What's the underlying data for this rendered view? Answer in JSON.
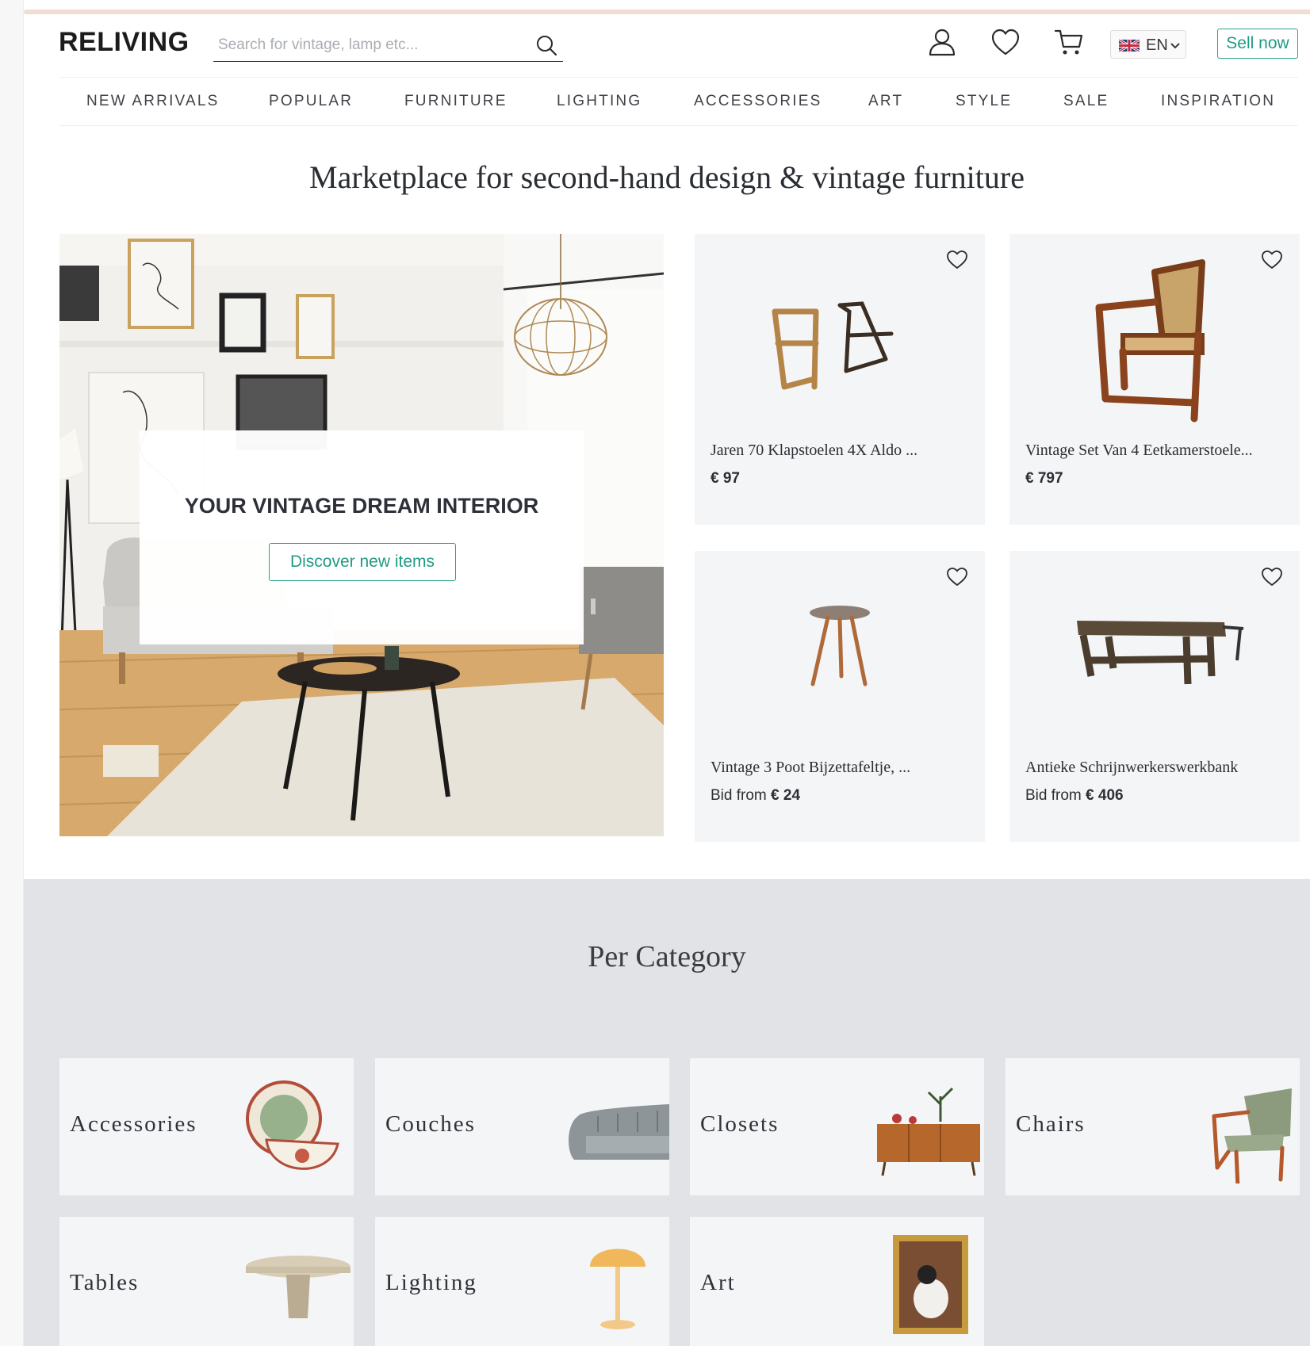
{
  "header": {
    "logo": "RELIVING",
    "search_placeholder": "Search for vintage, lamp etc...",
    "language": "EN",
    "sell_label": "Sell now"
  },
  "nav": {
    "items": [
      "NEW ARRIVALS",
      "POPULAR",
      "FURNITURE",
      "LIGHTING",
      "ACCESSORIES",
      "ART",
      "STYLE",
      "SALE",
      "INSPIRATION"
    ]
  },
  "headline": "Marketplace for second-hand design & vintage furniture",
  "hero": {
    "title": "YOUR VINTAGE DREAM INTERIOR",
    "button": "Discover new items"
  },
  "products": [
    {
      "name": "Jaren 70 Klapstoelen 4X Aldo ...",
      "price_prefix": "",
      "price": "€ 97"
    },
    {
      "name": "Vintage Set Van 4 Eetkamerstoele...",
      "price_prefix": "",
      "price": "€ 797"
    },
    {
      "name": "Vintage 3 Poot Bijzettafeltje, ...",
      "price_prefix": "Bid from ",
      "price": "€ 24"
    },
    {
      "name": "Antieke Schrijnwerkerswerkbank",
      "price_prefix": "Bid from ",
      "price": "€ 406"
    }
  ],
  "categories": {
    "title": "Per Category",
    "items": [
      "Accessories",
      "Couches",
      "Closets",
      "Chairs",
      "Tables",
      "Lighting",
      "Art"
    ]
  },
  "colors": {
    "accent": "#2aa08a",
    "card_bg": "#f4f5f7",
    "section_bg": "#e2e3e6"
  }
}
